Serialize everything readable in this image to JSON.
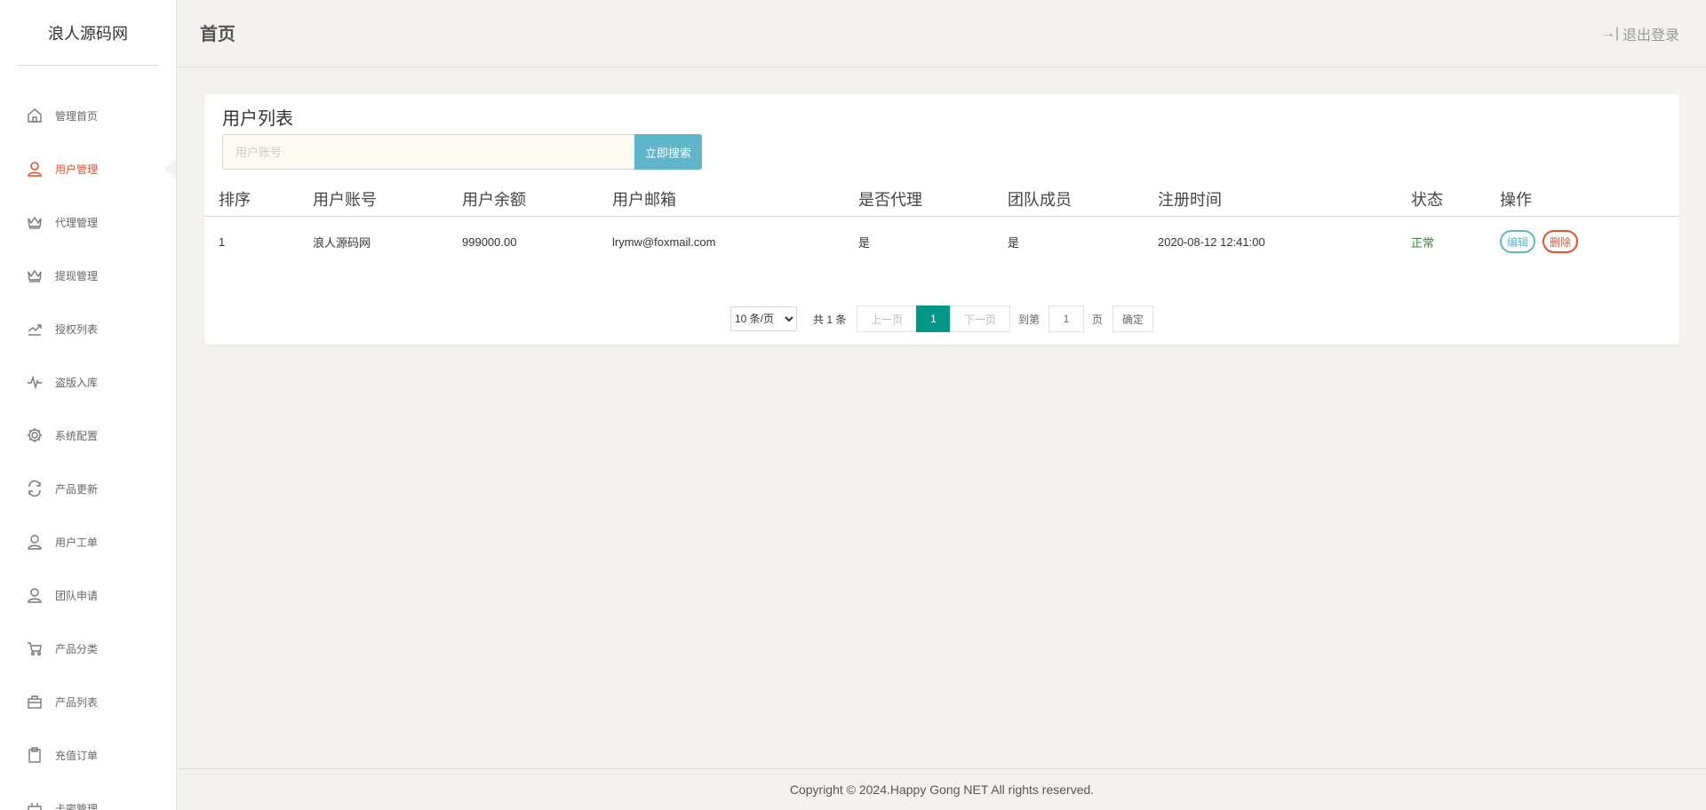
{
  "brand": "浪人源码网",
  "sidebar": {
    "items": [
      {
        "label": "管理首页",
        "icon": "home-icon"
      },
      {
        "label": "用户管理",
        "icon": "user-icon",
        "active": true
      },
      {
        "label": "代理管理",
        "icon": "crown-icon"
      },
      {
        "label": "提现管理",
        "icon": "crown-icon"
      },
      {
        "label": "授权列表",
        "icon": "trend-icon"
      },
      {
        "label": "盗版入库",
        "icon": "pulse-icon"
      },
      {
        "label": "系统配置",
        "icon": "gear-icon"
      },
      {
        "label": "产品更新",
        "icon": "refresh-icon"
      },
      {
        "label": "用户工单",
        "icon": "user-icon"
      },
      {
        "label": "团队申请",
        "icon": "user-icon"
      },
      {
        "label": "产品分类",
        "icon": "cart-icon"
      },
      {
        "label": "产品列表",
        "icon": "bag-icon"
      },
      {
        "label": "充值订单",
        "icon": "clipboard-icon"
      },
      {
        "label": "卡密管理",
        "icon": "box-icon"
      }
    ]
  },
  "header": {
    "title": "首页",
    "logout_label": "退出登录",
    "logout_icon": "→|"
  },
  "panel": {
    "title": "用户列表",
    "search": {
      "placeholder": "用户账号",
      "value": "",
      "button_label": "立即搜索"
    }
  },
  "table": {
    "columns": [
      "排序",
      "用户账号",
      "用户余额",
      "用户邮箱",
      "是否代理",
      "团队成员",
      "注册时间",
      "状态",
      "操作"
    ],
    "rows": [
      {
        "order": "1",
        "account": "浪人源码网",
        "balance": "999000.00",
        "email": "lrymw@foxmail.com",
        "is_agent": "是",
        "team_member": "是",
        "reg_time": "2020-08-12 12:41:00",
        "status": "正常",
        "edit_label": "编辑",
        "delete_label": "删除"
      }
    ]
  },
  "pagination": {
    "page_size_label": "10 条/页",
    "total_label": "共 1 条",
    "prev_label": "上一页",
    "current_page": "1",
    "next_label": "下一页",
    "goto_label": "到第",
    "goto_value": "1",
    "page_unit": "页",
    "confirm_label": "确定"
  },
  "footer": {
    "copyright": "Copyright © 2024.Happy Gong NET All rights reserved."
  },
  "colors": {
    "accent": "#e8512b",
    "search_button": "#5fb5c9",
    "pager_active": "#009688",
    "status_ok": "#2e8b2e"
  }
}
